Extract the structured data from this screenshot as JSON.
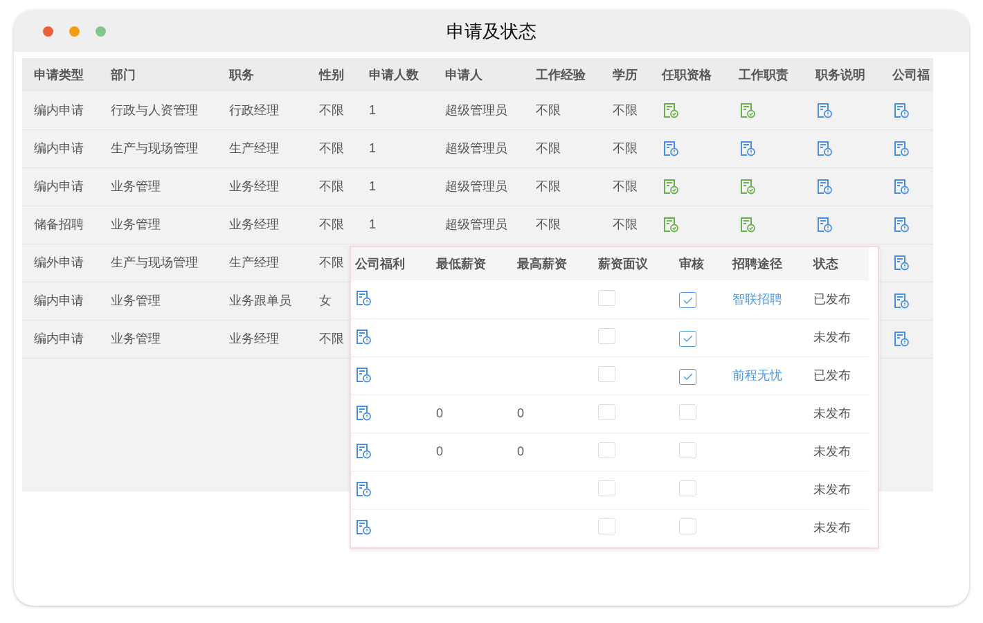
{
  "window": {
    "title": "申请及状态"
  },
  "table": {
    "columns": [
      "申请类型",
      "部门",
      "职务",
      "性别",
      "申请人数",
      "申请人",
      "工作经验",
      "学历",
      "任职资格",
      "工作职责",
      "职务说明",
      "公司福"
    ],
    "rows": [
      {
        "type": "编内申请",
        "dept": "行政与人资管理",
        "position": "行政经理",
        "gender": "不限",
        "count": "1",
        "applicant": "超级管理员",
        "experience": "不限",
        "education": "不限",
        "docs": {
          "qualification": {
            "kind": "approved"
          },
          "duties": {
            "kind": "approved"
          },
          "description": {
            "kind": "pending"
          },
          "benefits": {
            "kind": "pending"
          }
        }
      },
      {
        "type": "编内申请",
        "dept": "生产与现场管理",
        "position": "生产经理",
        "gender": "不限",
        "count": "1",
        "applicant": "超级管理员",
        "experience": "不限",
        "education": "不限",
        "docs": {
          "qualification": {
            "kind": "pending"
          },
          "duties": {
            "kind": "pending"
          },
          "description": {
            "kind": "pending"
          },
          "benefits": {
            "kind": "pending"
          }
        }
      },
      {
        "type": "编内申请",
        "dept": "业务管理",
        "position": "业务经理",
        "gender": "不限",
        "count": "1",
        "applicant": "超级管理员",
        "experience": "不限",
        "education": "不限",
        "docs": {
          "qualification": {
            "kind": "approved"
          },
          "duties": {
            "kind": "approved"
          },
          "description": {
            "kind": "pending"
          },
          "benefits": {
            "kind": "pending"
          }
        }
      },
      {
        "type": "储备招聘",
        "dept": "业务管理",
        "position": "业务经理",
        "gender": "不限",
        "count": "1",
        "applicant": "超级管理员",
        "experience": "不限",
        "education": "不限",
        "docs": {
          "qualification": {
            "kind": "approved"
          },
          "duties": {
            "kind": "approved"
          },
          "description": {
            "kind": "pending"
          },
          "benefits": {
            "kind": "pending"
          }
        }
      },
      {
        "type": "编外申请",
        "dept": "生产与现场管理",
        "position": "生产经理",
        "gender": "不限",
        "docs": {
          "benefits": {
            "kind": "pending"
          }
        }
      },
      {
        "type": "编内申请",
        "dept": "业务管理",
        "position": "业务跟单员",
        "gender": "女",
        "docs": {
          "benefits": {
            "kind": "pending"
          }
        }
      },
      {
        "type": "编内申请",
        "dept": "业务管理",
        "position": "业务经理",
        "gender": "不限",
        "docs": {
          "benefits": {
            "kind": "pending"
          }
        }
      }
    ]
  },
  "popup": {
    "columns": [
      "公司福利",
      "最低薪资",
      "最高薪资",
      "薪资面议",
      "审核",
      "招聘途径",
      "状态"
    ],
    "rows": [
      {
        "benefits": {
          "kind": "pending"
        },
        "negotiable": false,
        "reviewed": true,
        "channel": "智联招聘",
        "status": "已发布"
      },
      {
        "benefits": {
          "kind": "pending"
        },
        "negotiable": false,
        "reviewed": true,
        "status": "未发布"
      },
      {
        "benefits": {
          "kind": "pending"
        },
        "negotiable": false,
        "reviewed": true,
        "channel": "前程无忧",
        "status": "已发布"
      },
      {
        "benefits": {
          "kind": "pending"
        },
        "min_salary": "0",
        "max_salary": "0",
        "negotiable": false,
        "reviewed": false,
        "status": "未发布"
      },
      {
        "benefits": {
          "kind": "pending"
        },
        "min_salary": "0",
        "max_salary": "0",
        "negotiable": false,
        "reviewed": false,
        "status": "未发布"
      },
      {
        "benefits": {
          "kind": "pending"
        },
        "negotiable": false,
        "reviewed": false,
        "status": "未发布"
      },
      {
        "benefits": {
          "kind": "pending"
        },
        "negotiable": false,
        "reviewed": false,
        "status": "未发布"
      }
    ]
  }
}
